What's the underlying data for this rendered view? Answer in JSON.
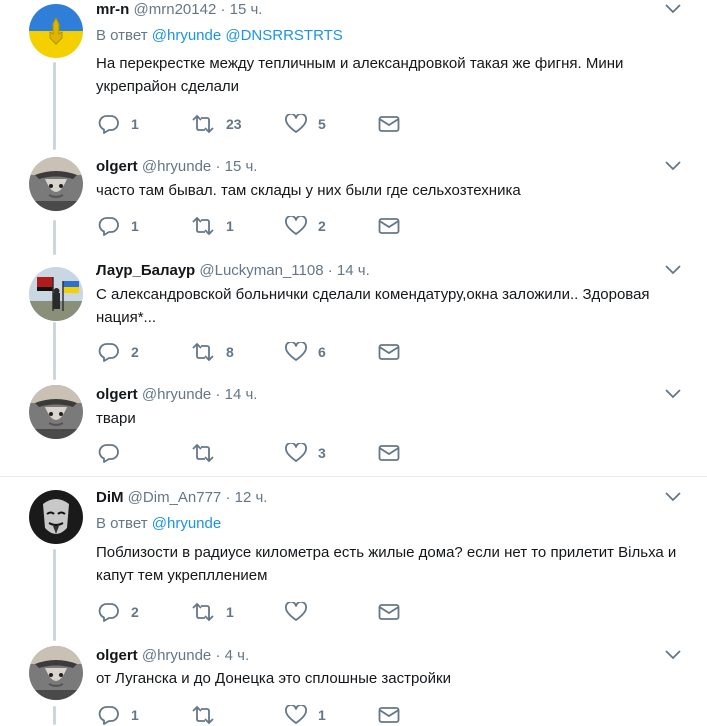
{
  "colors": {
    "accent": "#1b95e0",
    "muted": "#657786",
    "text": "#14171a",
    "line": "#ccd6dd"
  },
  "tweets": [
    {
      "name": "mr-n",
      "handle": "@mrn20142",
      "dot": "·",
      "time": "15 ч.",
      "reply_prefix": "В ответ",
      "reply_mentions": "@hryunde @DNSRRSTRTS",
      "text": "На перекрестке между тепличным и александровкой такая же фигня. Мини укрепрайон сделали",
      "reply_count": "1",
      "retweet_count": "23",
      "like_count": "5"
    },
    {
      "name": "olgert",
      "handle": "@hryunde",
      "dot": "·",
      "time": "15 ч.",
      "text": "часто там  бывал. там склады у них были где сельхозтехника",
      "reply_count": "1",
      "retweet_count": "1",
      "like_count": "2"
    },
    {
      "name": "Лаур_Балаур",
      "handle": "@Luckyman_1108",
      "dot": "·",
      "time": "14 ч.",
      "text": "С александровской больнички сделали комендатуру,окна заложили.. Здоровая нация*...",
      "reply_count": "2",
      "retweet_count": "8",
      "like_count": "6"
    },
    {
      "name": "olgert",
      "handle": "@hryunde",
      "dot": "·",
      "time": "14 ч.",
      "text": "твари",
      "reply_count": "",
      "retweet_count": "",
      "like_count": "3"
    },
    {
      "name": "DiM",
      "handle": "@Dim_An777",
      "dot": "·",
      "time": "12 ч.",
      "reply_prefix": "В ответ",
      "reply_mentions": "@hryunde",
      "text": "Поблизости в радиусе километра есть жилые дома?  если нет то прилетит Вільха и капут тем укрепллением",
      "reply_count": "2",
      "retweet_count": "1",
      "like_count": ""
    },
    {
      "name": "olgert",
      "handle": "@hryunde",
      "dot": "·",
      "time": "4 ч.",
      "text": "от Луганска и до Донецка это сплошные застройки",
      "reply_count": "1",
      "retweet_count": "",
      "like_count": "1"
    }
  ]
}
